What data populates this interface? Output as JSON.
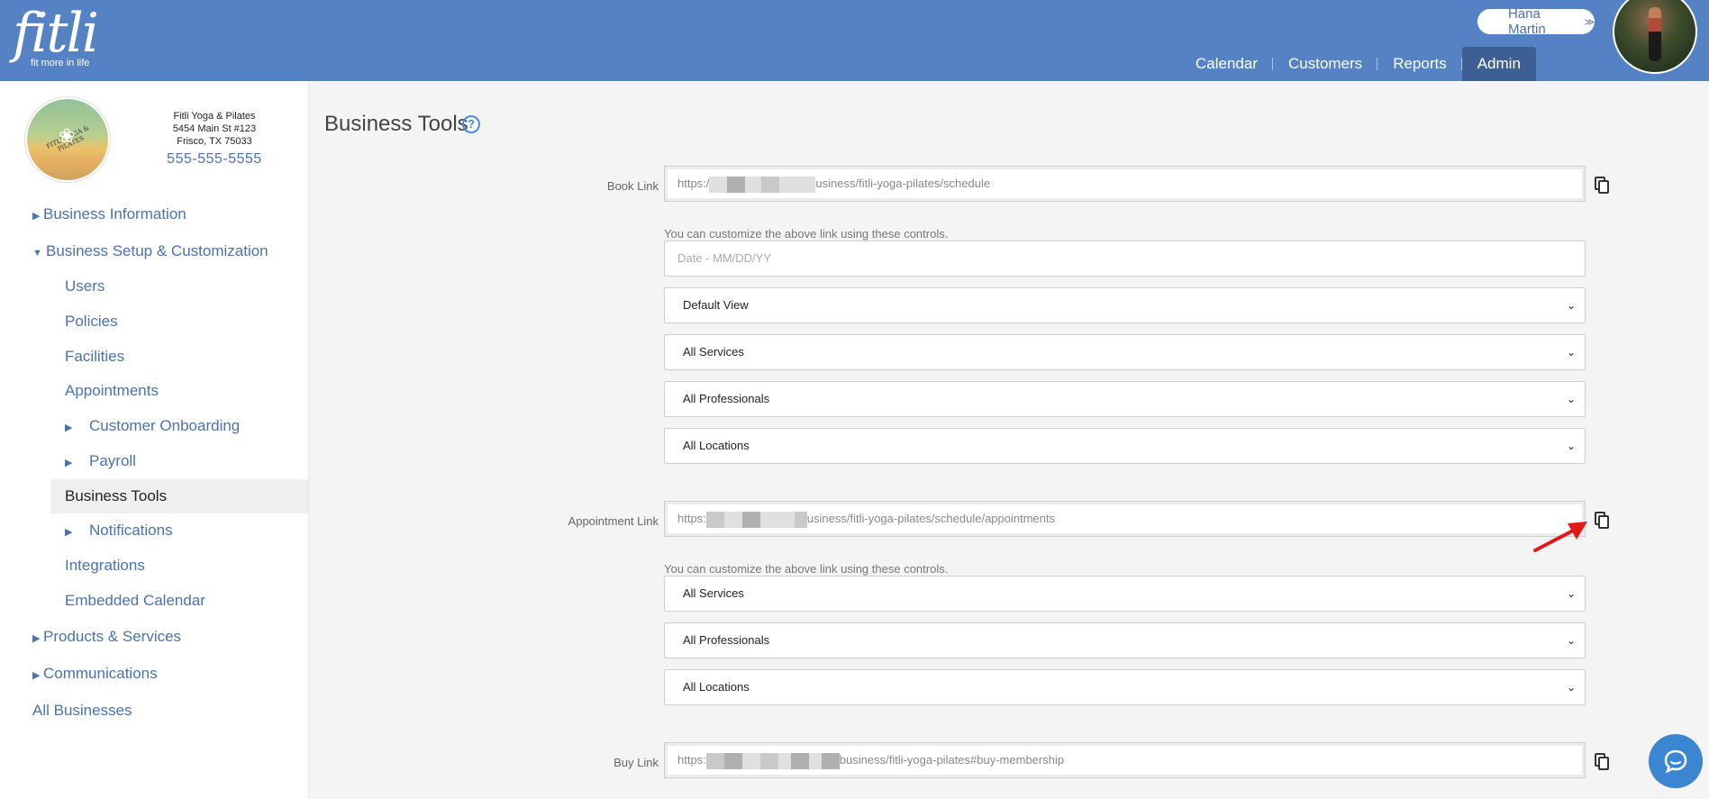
{
  "header": {
    "logo_word": "fitli",
    "logo_tagline": "fit more in life",
    "user_name": "Hana Martin",
    "user_chevron": "≫",
    "nav": [
      "Calendar",
      "Customers",
      "Reports",
      "Admin"
    ],
    "active_nav": "Admin",
    "accent_color": "#5582c4"
  },
  "business": {
    "name": "Fitli Yoga & Pilates",
    "address_line1": "5454 Main St #123",
    "address_line2": "Frisco, TX 75033",
    "phone": "555-555-5555",
    "logo_ring_text": "FITLI YOGA & PILATES"
  },
  "sidebar": {
    "business_information": "Business Information",
    "business_setup": "Business Setup & Customization",
    "users": "Users",
    "policies": "Policies",
    "facilities": "Facilities",
    "appointments": "Appointments",
    "customer_onboarding": "Customer Onboarding",
    "payroll": "Payroll",
    "business_tools": "Business Tools",
    "notifications": "Notifications",
    "integrations": "Integrations",
    "embedded_calendar": "Embedded Calendar",
    "products_services": "Products & Services",
    "communications": "Communications",
    "all_businesses": "All Businesses"
  },
  "main": {
    "title": "Business Tools",
    "help": "?",
    "book": {
      "label": "Book Link",
      "url_prefix": "https:/",
      "url_suffix": "usiness/fitli-yoga-pilates/schedule",
      "hint": "You can customize the above link using these controls.",
      "date_placeholder": "Date - MM/DD/YY",
      "selects": [
        "Default View",
        "All Services",
        "All Professionals",
        "All Locations"
      ]
    },
    "appointment": {
      "label": "Appointment Link",
      "url_prefix": "https:",
      "url_suffix": "usiness/fitli-yoga-pilates/schedule/appointments",
      "hint": "You can customize the above link using these controls.",
      "selects": [
        "All Services",
        "All Professionals",
        "All Locations"
      ]
    },
    "buy": {
      "label": "Buy Link",
      "url_prefix": "https:",
      "url_suffix": "business/fitli-yoga-pilates#buy-membership"
    }
  }
}
